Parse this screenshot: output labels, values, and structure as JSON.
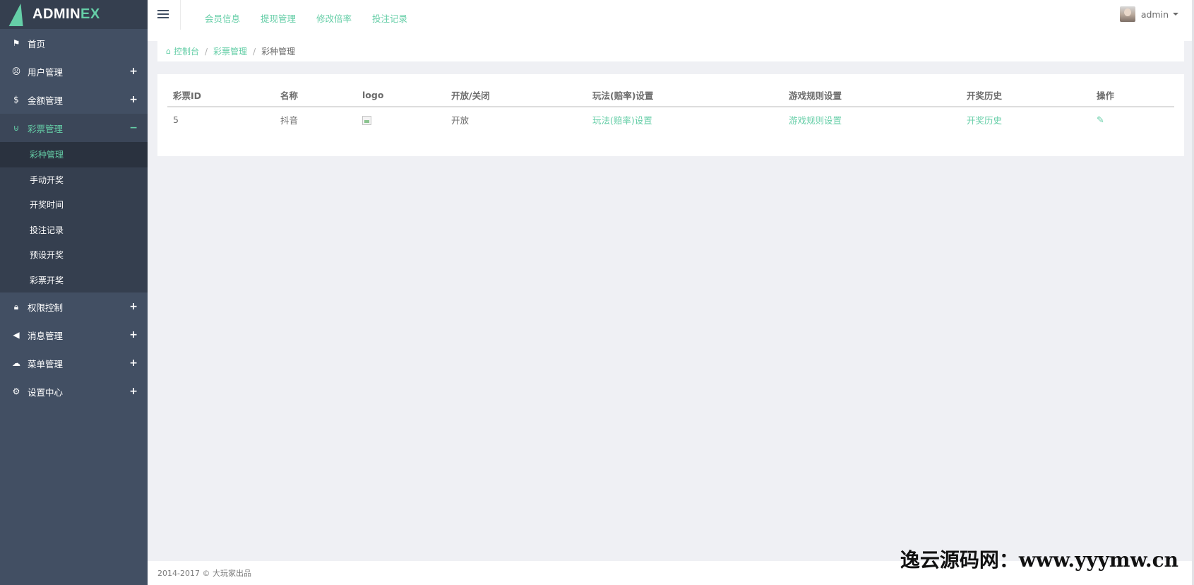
{
  "app": {
    "logo_prefix": "ADMIN",
    "logo_accent": "EX"
  },
  "colors": {
    "accent": "#65cea7",
    "sidebar": "#424f63",
    "sidebar_dark": "#353f4f"
  },
  "sidebar": {
    "items": [
      {
        "label": "首页",
        "icon": "flag-icon"
      },
      {
        "label": "用户管理",
        "icon": "user-face-icon",
        "toggle": "+"
      },
      {
        "label": "金额管理",
        "icon": "dollar-icon",
        "toggle": "+"
      },
      {
        "label": "彩票管理",
        "icon": "magnet-icon",
        "toggle": "−"
      },
      {
        "label": "权限控制",
        "icon": "lock-icon",
        "toggle": "+"
      },
      {
        "label": "消息管理",
        "icon": "megaphone-icon",
        "toggle": "+"
      },
      {
        "label": "菜单管理",
        "icon": "cloud-icon",
        "toggle": "+"
      },
      {
        "label": "设置中心",
        "icon": "gear-icon",
        "toggle": "+"
      }
    ],
    "lottery_sub": [
      {
        "label": "彩种管理"
      },
      {
        "label": "手动开奖"
      },
      {
        "label": "开奖时间"
      },
      {
        "label": "投注记录"
      },
      {
        "label": "预设开奖"
      },
      {
        "label": "彩票开奖"
      }
    ]
  },
  "header": {
    "links": [
      {
        "label": "会员信息"
      },
      {
        "label": "提现管理"
      },
      {
        "label": "修改倍率"
      },
      {
        "label": "投注记录"
      }
    ],
    "user": "admin"
  },
  "breadcrumb": {
    "home": "控制台",
    "parent": "彩票管理",
    "current": "彩种管理",
    "separator": "/"
  },
  "table": {
    "columns": [
      "彩票ID",
      "名称",
      "logo",
      "开放/关闭",
      "玩法(赔率)设置",
      "游戏规则设置",
      "开奖历史",
      "操作"
    ],
    "rows": [
      {
        "id": "5",
        "name": "抖音",
        "status": "开放",
        "odds_link": "玩法(赔率)设置",
        "rules_link": "游戏规则设置",
        "history_link": "开奖历史"
      }
    ]
  },
  "footer": {
    "copyright": "2014-2017 © 大玩家出品"
  },
  "watermark": "逸云源码网：www.yyymw.cn"
}
